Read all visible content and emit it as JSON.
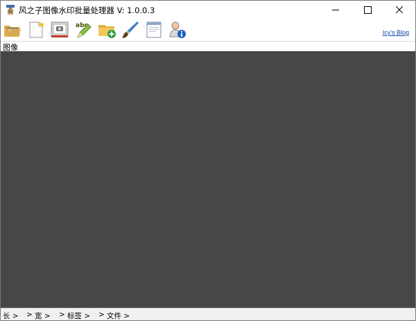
{
  "window": {
    "title": "风之子图像水印批量处理器  V: 1.0.0.3"
  },
  "toolbar": {
    "items": [
      {
        "name": "open-images-icon"
      },
      {
        "name": "new-project-icon"
      },
      {
        "name": "picture-watermark-icon"
      },
      {
        "name": "text-watermark-icon"
      },
      {
        "name": "add-folder-icon"
      },
      {
        "name": "brush-icon"
      },
      {
        "name": "window-preview-icon"
      },
      {
        "name": "about-info-icon"
      }
    ],
    "blog_link": "Icy's Blog"
  },
  "section": {
    "label": "图像"
  },
  "status": {
    "length": "长 >",
    "gt1": ">",
    "width": "宽 >",
    "gt2": ">",
    "tag": "标签 >",
    "gt3": ">",
    "file": "文件 >"
  },
  "colors": {
    "canvas_bg": "#474747",
    "statusbar_bg": "#f0f0f0",
    "link": "#0645ad"
  }
}
